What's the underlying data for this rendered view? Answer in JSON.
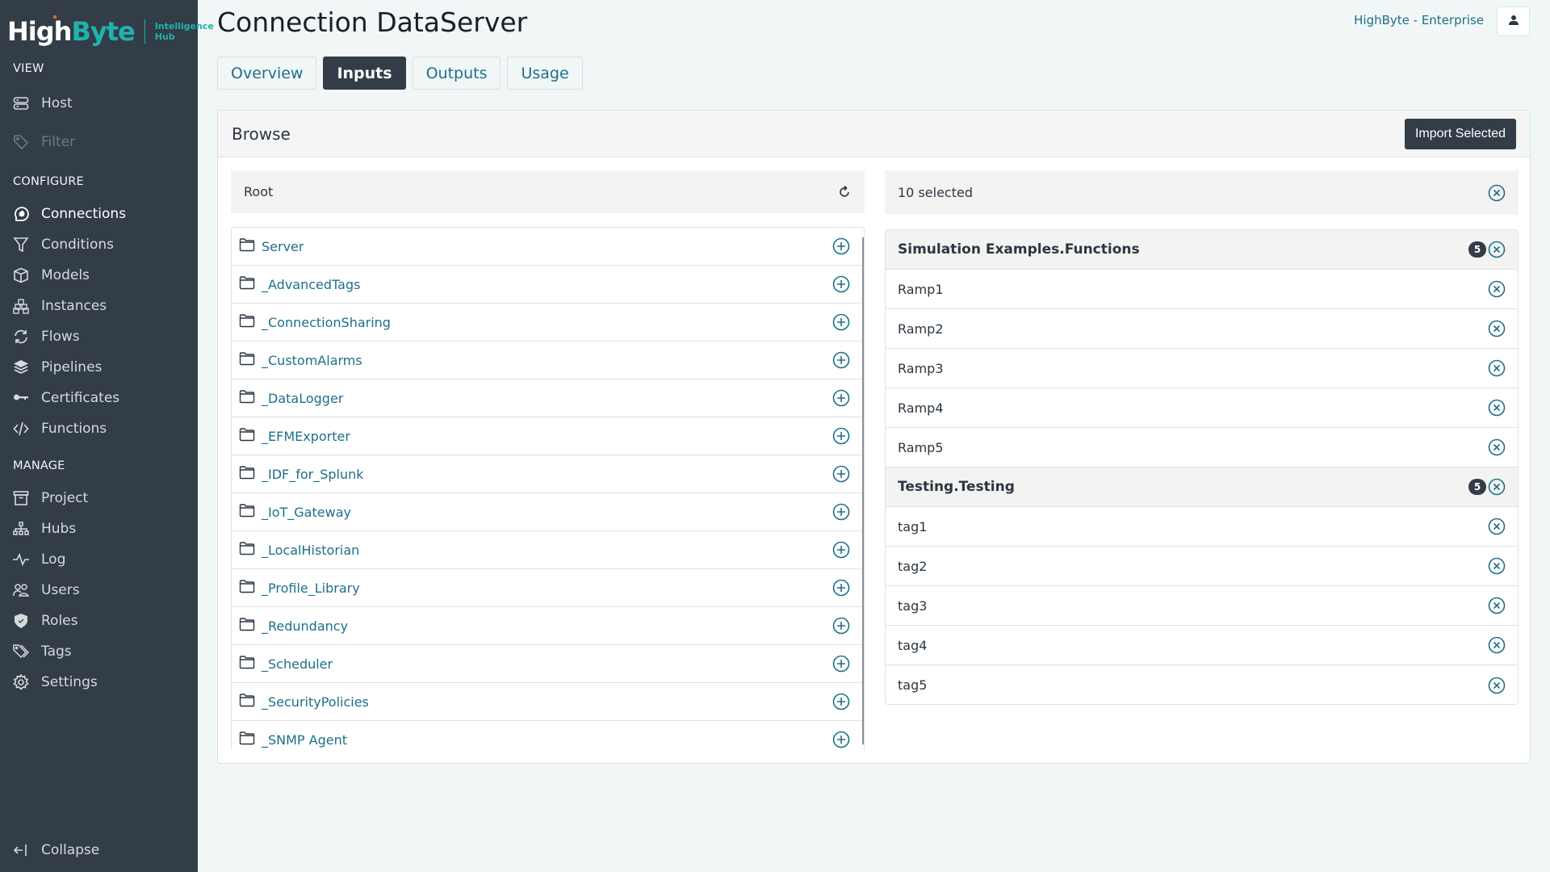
{
  "brand": {
    "name_part1": "High",
    "name_part2": "Byte",
    "subtitle_line1": "Intelligence",
    "subtitle_line2": "Hub"
  },
  "sidebar": {
    "sections": [
      {
        "label": "VIEW"
      },
      {
        "label": "CONFIGURE"
      },
      {
        "label": "MANAGE"
      }
    ],
    "view_items": [
      {
        "label": "Host",
        "icon": "server-icon"
      },
      {
        "label": "Filter",
        "icon": "tag-icon",
        "disabled": true
      }
    ],
    "configure_items": [
      {
        "label": "Connections",
        "icon": "plug-icon",
        "active": true
      },
      {
        "label": "Conditions",
        "icon": "filter-icon"
      },
      {
        "label": "Models",
        "icon": "cube-icon"
      },
      {
        "label": "Instances",
        "icon": "cubes-icon"
      },
      {
        "label": "Flows",
        "icon": "sync-icon"
      },
      {
        "label": "Pipelines",
        "icon": "layers-icon"
      },
      {
        "label": "Certificates",
        "icon": "key-icon"
      },
      {
        "label": "Functions",
        "icon": "code-icon"
      }
    ],
    "manage_items": [
      {
        "label": "Project",
        "icon": "archive-icon"
      },
      {
        "label": "Hubs",
        "icon": "sitemap-icon"
      },
      {
        "label": "Log",
        "icon": "pulse-icon"
      },
      {
        "label": "Users",
        "icon": "users-icon"
      },
      {
        "label": "Roles",
        "icon": "shield-icon"
      },
      {
        "label": "Tags",
        "icon": "tags-icon"
      },
      {
        "label": "Settings",
        "icon": "gear-icon"
      }
    ],
    "collapse_label": "Collapse"
  },
  "header": {
    "title": "Connection DataServer",
    "tenant": "HighByte - Enterprise"
  },
  "tabs": [
    {
      "label": "Overview",
      "active": false
    },
    {
      "label": "Inputs",
      "active": true
    },
    {
      "label": "Outputs",
      "active": false
    },
    {
      "label": "Usage",
      "active": false
    }
  ],
  "browse": {
    "title": "Browse",
    "import_label": "Import Selected",
    "root_label": "Root",
    "folders": [
      "Server",
      "_AdvancedTags",
      "_ConnectionSharing",
      "_CustomAlarms",
      "_DataLogger",
      "_EFMExporter",
      "_IDF_for_Splunk",
      "_IoT_Gateway",
      "_LocalHistorian",
      "_Profile_Library",
      "_Redundancy",
      "_Scheduler",
      "_SecurityPolicies",
      "_SNMP Agent"
    ],
    "selected_summary": "10 selected",
    "groups": [
      {
        "name": "Simulation Examples.Functions",
        "count": "5",
        "items": [
          "Ramp1",
          "Ramp2",
          "Ramp3",
          "Ramp4",
          "Ramp5"
        ]
      },
      {
        "name": "Testing.Testing",
        "count": "5",
        "items": [
          "tag1",
          "tag2",
          "tag3",
          "tag4",
          "tag5"
        ]
      }
    ]
  },
  "colors": {
    "sidebar_bg": "#333d47",
    "accent_teal": "#1fb3ad",
    "link_blue": "#1d6f8a",
    "page_bg": "#f1f6f6"
  }
}
